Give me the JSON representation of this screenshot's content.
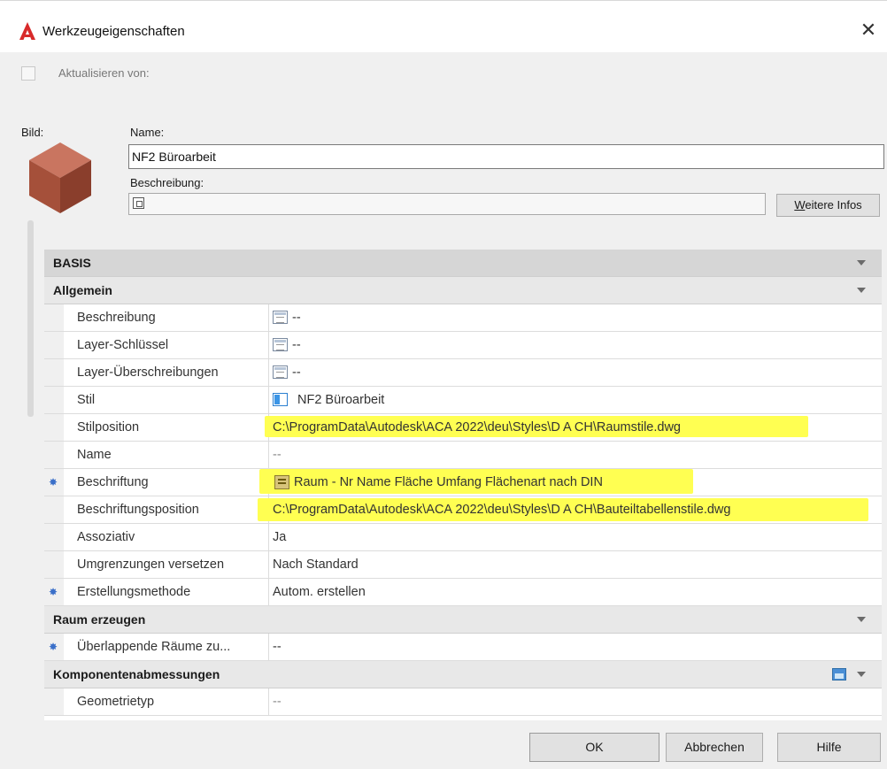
{
  "window": {
    "title": "Werkzeugeigenschaften",
    "close_glyph": "✕"
  },
  "update_from": {
    "label": "Aktualisieren von:",
    "checked": false
  },
  "image": {
    "label": "Bild:",
    "icon": "cube-icon"
  },
  "name": {
    "label": "Name:",
    "value": "NF2 Büroarbeit"
  },
  "description": {
    "label": "Beschreibung:",
    "value": ""
  },
  "more_info": {
    "underlined_letter": "W",
    "rest": "eitere Infos"
  },
  "grid": {
    "basis": "BASIS",
    "allgemein": "Allgemein",
    "raum_erzeugen": "Raum erzeugen",
    "komponenten": "Komponentenabmessungen",
    "properties": [
      {
        "name": "Beschreibung",
        "value": "--",
        "icon": "list-icon"
      },
      {
        "name": "Layer-Schlüssel",
        "value": "--",
        "icon": "list-icon"
      },
      {
        "name": "Layer-Überschreibungen",
        "value": "--",
        "icon": "list-icon"
      },
      {
        "name": "Stil",
        "value": "NF2 Büroarbeit",
        "icon": "style-icon"
      },
      {
        "name": "Stilposition",
        "value": "C:\\ProgramData\\Autodesk\\ACA 2022\\deu\\Styles\\D A CH\\Raumstile.dwg"
      },
      {
        "name": "Name",
        "value": "--"
      },
      {
        "name": "Beschriftung",
        "value": "Raum - Nr Name Fläche Umfang Flächenart nach DIN",
        "icon": "label-icon"
      },
      {
        "name": "Beschriftungsposition",
        "value": "C:\\ProgramData\\Autodesk\\ACA 2022\\deu\\Styles\\D A CH\\Bauteiltabellenstile.dwg"
      },
      {
        "name": "Assoziativ",
        "value": "Ja"
      },
      {
        "name": "Umgrenzungen versetzen",
        "value": "Nach Standard"
      },
      {
        "name": "Erstellungsmethode",
        "value": "Autom. erstellen"
      }
    ],
    "raum_props": [
      {
        "name": "Überlappende Räume zu...",
        "value": "--"
      }
    ],
    "komp_props": [
      {
        "name": "Geometrietyp",
        "value": "--"
      }
    ]
  },
  "buttons": {
    "ok": "OK",
    "cancel": "Abbrechen",
    "help": "Hilfe"
  },
  "colors": {
    "highlight": "#ffff52",
    "accent": "#3a6fc9",
    "autodesk_red": "#d82a2a"
  }
}
